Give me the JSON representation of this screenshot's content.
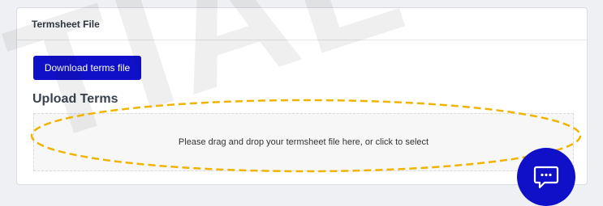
{
  "watermark": {
    "text": "TIAL"
  },
  "card": {
    "title": "Termsheet File"
  },
  "toolbar": {
    "download_label": "Download terms file"
  },
  "upload": {
    "heading": "Upload Terms",
    "dropzone_text": "Please drag and drop your termsheet file here, or click to select"
  },
  "colors": {
    "primary": "#1010c8",
    "annotation": "#f0b400",
    "background": "#eef0f3"
  },
  "icons": {
    "chat": "chat-bubble-icon"
  }
}
